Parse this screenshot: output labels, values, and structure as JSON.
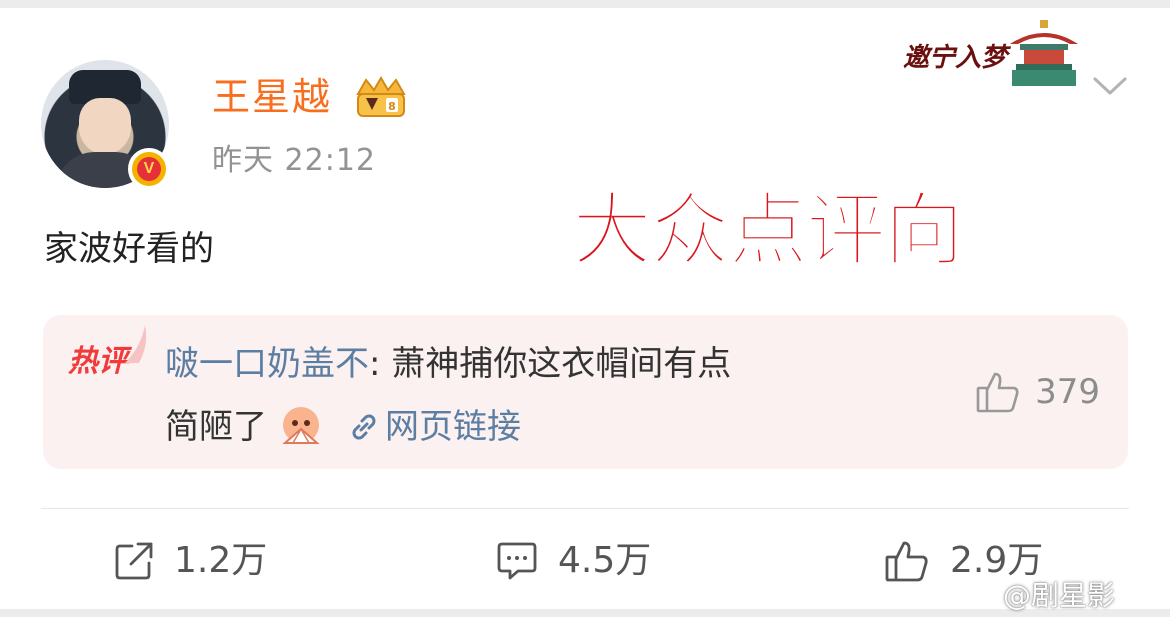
{
  "post": {
    "username": "王星越",
    "timestamp": "昨天 22:12",
    "text": "家波好看的",
    "verified_badge": "V",
    "overlay_title": "大众点评向",
    "watermark": "邀宁入梦"
  },
  "hot_comment": {
    "tag": "热评",
    "author": "啵一口奶盖不",
    "separator": ": ",
    "text_line1": "萧神捕你这衣帽间有点",
    "text_line2": "简陋了",
    "link_label": "网页链接",
    "like_count": "379"
  },
  "actions": {
    "repost_count": "1.2万",
    "comment_count": "4.5万",
    "like_count": "2.9万"
  },
  "corner_watermark": "@剧星影",
  "colors": {
    "username": "#f86e1d",
    "link": "#5c7ea3",
    "hot_tag": "#f13a3a",
    "overlay_title": "#d9161d",
    "hot_comment_bg": "#fbf1f1"
  },
  "icons": {
    "crown": "crown-icon",
    "chevron": "chevron-down-icon",
    "link": "link-icon",
    "thumb": "thumbs-up-icon",
    "repost": "share-icon",
    "comment": "comment-icon"
  }
}
